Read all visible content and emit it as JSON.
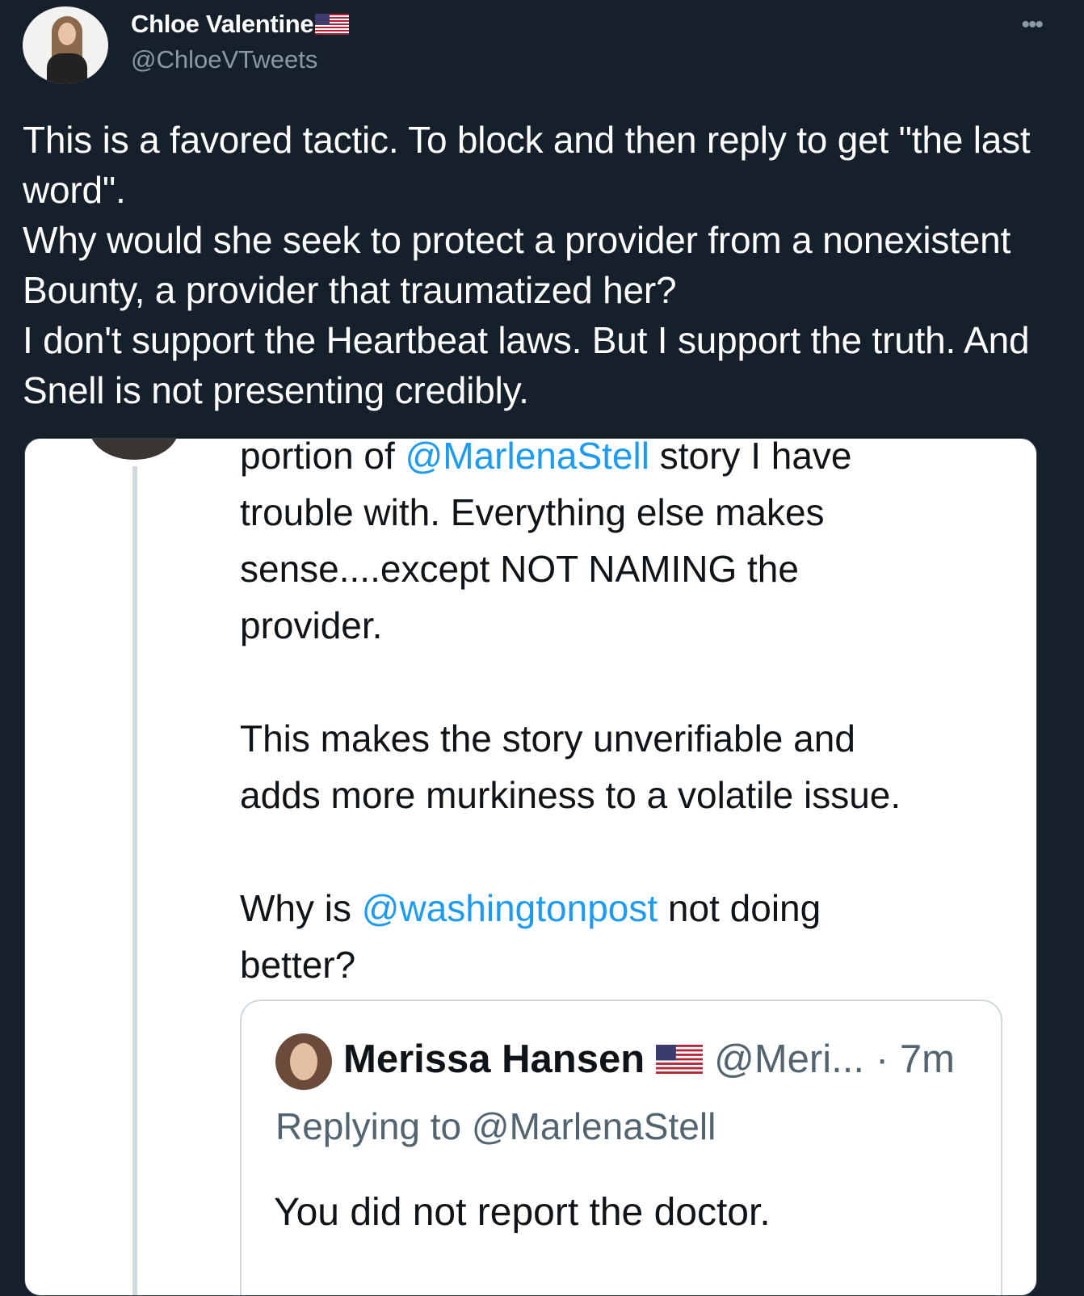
{
  "author": {
    "name": "Chloe Valentine",
    "flag": "us-flag-emoji",
    "handle": "@ChloeVTweets",
    "more_icon": "more-options-icon"
  },
  "tweet": {
    "text": "This is a favored tactic.  To block and then reply to get \"the last word\".\nWhy would she seek to protect a provider from a nonexistent Bounty, a provider that traumatized her?\nI don't support the Heartbeat laws.  But I support the truth.  And Snell is not presenting credibly."
  },
  "screenshot": {
    "line1_pre": "portion of ",
    "line1_mention": "@MarlenaStell",
    "line1_post": " story I have",
    "para1_rest": "trouble with.   Everything else makes\nsense....except NOT NAMING the\nprovider.",
    "para2": "This makes the story unverifiable and\nadds more murkiness to a volatile issue.",
    "para3_pre": "Why is ",
    "para3_mention": "@washingtonpost",
    "para3_post": " not doing\nbetter?",
    "quoted": {
      "name": "Merissa Hansen",
      "handle": "@Meri...",
      "time": "· 7m",
      "replying_label": "Replying to ",
      "replying_to": "@MarlenaStell",
      "text": "You did not report the doctor."
    }
  }
}
